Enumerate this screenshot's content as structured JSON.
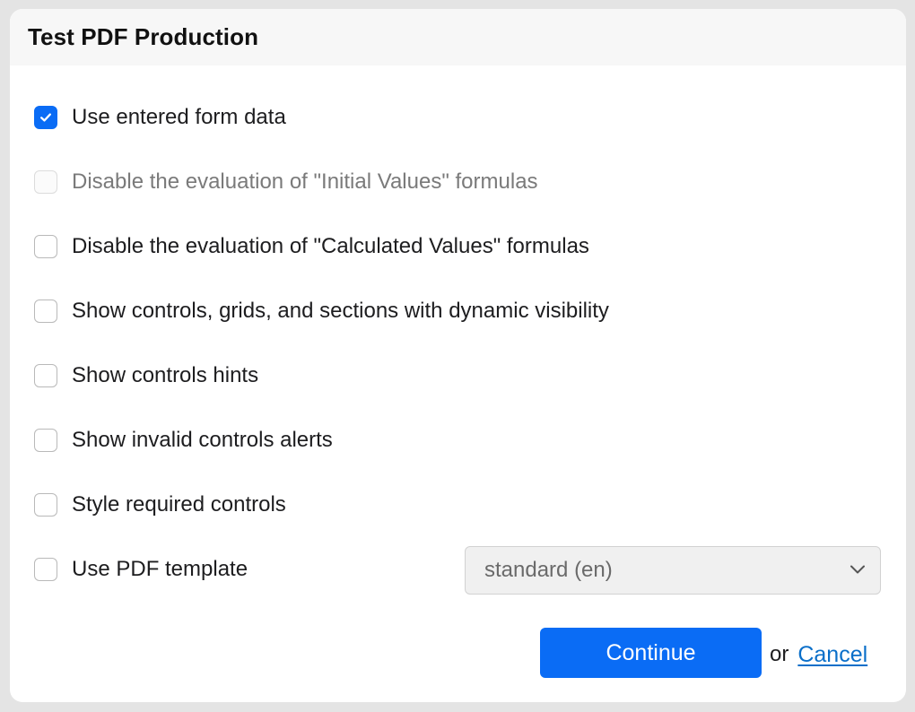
{
  "dialog": {
    "title": "Test PDF Production"
  },
  "options": [
    {
      "label": "Use entered form data",
      "checked": true,
      "disabled": false
    },
    {
      "label": "Disable the evaluation of \"Initial Values\" formulas",
      "checked": false,
      "disabled": true
    },
    {
      "label": "Disable the evaluation of \"Calculated Values\" formulas",
      "checked": false,
      "disabled": false
    },
    {
      "label": "Show controls, grids, and sections with dynamic visibility",
      "checked": false,
      "disabled": false
    },
    {
      "label": "Show controls hints",
      "checked": false,
      "disabled": false
    },
    {
      "label": "Show invalid controls alerts",
      "checked": false,
      "disabled": false
    },
    {
      "label": "Style required controls",
      "checked": false,
      "disabled": false
    },
    {
      "label": "Use PDF template",
      "checked": false,
      "disabled": false
    }
  ],
  "template_select": {
    "selected": "standard (en)",
    "disabled": true
  },
  "footer": {
    "continue_label": "Continue",
    "or_text": "or",
    "cancel_label": "Cancel"
  },
  "colors": {
    "accent": "#0a6cf5",
    "link": "#0a6fc9",
    "header_bg": "#f7f7f7",
    "backdrop": "#e4e4e4"
  }
}
